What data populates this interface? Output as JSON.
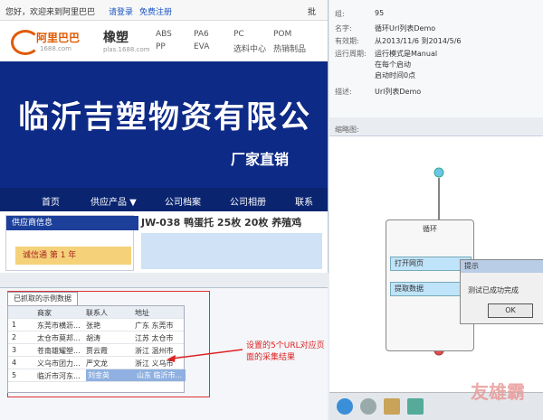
{
  "browser": {
    "greeting": "您好，欢迎来到阿里巴巴",
    "login": "请登录",
    "register": "免费注册",
    "partial": "批",
    "logo_text": "阿里巴巴",
    "logo_url": "1688.com",
    "brand_cn": "橡塑",
    "brand_url": "plas.1688.com",
    "nav_links": [
      "ABS",
      "PP",
      "PA6",
      "EVA",
      "PC",
      "选料中心",
      "POM",
      "热销制品"
    ],
    "banner_title": "临沂吉塑物资有限公",
    "banner_sub": "厂家直销",
    "nav_items": [
      "首页",
      "供应产品 ▼",
      "公司档案",
      "公司相册",
      "联系"
    ],
    "supplier_header": "供应商信息",
    "supplier_badge": "诚信通  第 1 年",
    "product_title": "JW-038 鸭蛋托  25枚  20枚  养殖鸡"
  },
  "data_panel": {
    "tab": "已抓取的示例数据",
    "columns": [
      "",
      "商家",
      "联系人",
      "地址"
    ],
    "rows": [
      [
        "1",
        "东莞市横沥...",
        "张艳",
        "广东 东莞市"
      ],
      [
        "2",
        "太仓市莫邦...",
        "胡涛",
        "江苏 太仓市"
      ],
      [
        "3",
        "苍南雄耀塑...",
        "贾云霞",
        "浙江 温州市"
      ],
      [
        "4",
        "义乌市团力...",
        "严文龙",
        "浙江 义乌市"
      ],
      [
        "5",
        "临沂市河东...",
        "刘金英",
        "山东 临沂市..."
      ]
    ],
    "annotation": "设置的5个URL对应页面的采集结果"
  },
  "props": {
    "labels": [
      "组:",
      "名字:",
      "有效期:",
      "运行周期:",
      "",
      "",
      "描述:"
    ],
    "values": [
      "95",
      "循环Url列表Demo",
      "从2013/11/6 到2014/5/6",
      "运行模式是Manual",
      "在每个启动",
      "启动时间0点",
      "Url列表Demo"
    ],
    "thumb_label": "缩略图:"
  },
  "canvas": {
    "loop_label": "循环",
    "node_open": "打开网页",
    "node_extract": "提取数据"
  },
  "dialog": {
    "title": "提示",
    "message": "测试已成功完成",
    "ok": "OK"
  },
  "watermark": "友雄霸"
}
